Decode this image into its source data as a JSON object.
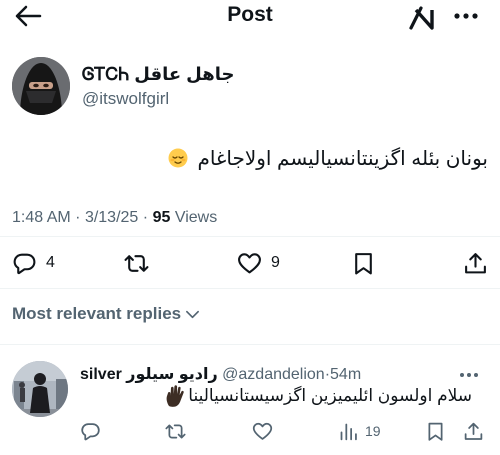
{
  "header": {
    "title": "Post"
  },
  "author": {
    "display_name": "ᎶᎢᏟᏂ جاهل عاقل",
    "handle": "@itswolfgirl"
  },
  "tweet": {
    "text": "بونان بئله اگزینتانسیالیسم اولاجاغام",
    "time": "1:48 AM",
    "date": "3/13/25",
    "separator": "·",
    "views_count": "95",
    "views_label": "Views"
  },
  "actions": {
    "replies": "4",
    "likes": "9"
  },
  "replies_sort": {
    "label": "Most relevant replies"
  },
  "reply": {
    "display_name": "silver رادیو سیلور",
    "handle": "@azdandelion",
    "age": "54m",
    "dot": "·",
    "text": "سلام اولسون ائلیمیزین اگزسیستانسیالینا",
    "views": "19"
  },
  "colors": {
    "text_primary": "#0f1419",
    "text_secondary": "#536471",
    "divider": "#eff3f4",
    "emoji_face": "#ffcc4d",
    "emoji_hand": "#3d2d24"
  },
  "icons": [
    "back-arrow-icon",
    "grok-icon",
    "more-icon",
    "reply-icon",
    "retweet-icon",
    "like-icon",
    "bookmark-icon",
    "share-icon",
    "chevron-down-icon",
    "views-icon",
    "relieved-face-emoji",
    "raised-hand-emoji"
  ]
}
